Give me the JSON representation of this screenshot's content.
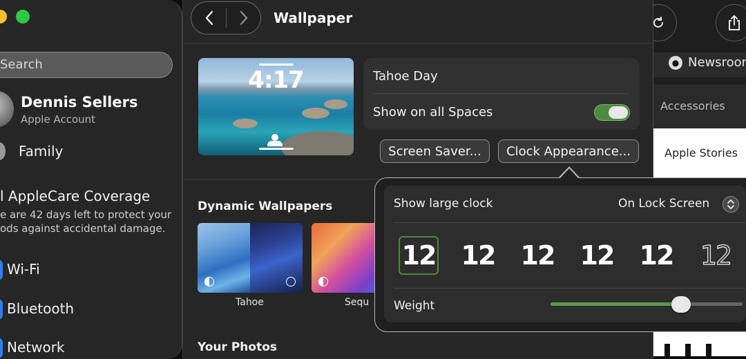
{
  "sidebar": {
    "search_placeholder": "Search",
    "account": {
      "name": "Dennis Sellers",
      "subtitle": "Apple Account"
    },
    "family_label": "Family",
    "applecare": {
      "title": "l AppleCare Coverage",
      "line1": "e are 42 days left to protect your",
      "line2": "ods against accidental damage."
    },
    "items": [
      {
        "label": "Wi-Fi",
        "icon": "wifi-icon"
      },
      {
        "label": "Bluetooth",
        "icon": "bluetooth-icon"
      },
      {
        "label": "Network",
        "icon": "network-icon"
      }
    ]
  },
  "toolbar": {
    "title": "Wallpaper"
  },
  "wallpaper": {
    "preview_time": "4:17",
    "name": "Tahoe Day",
    "show_on_all_spaces_label": "Show on all Spaces",
    "show_on_all_spaces": true,
    "screen_saver_button": "Screen Saver...",
    "clock_appearance_button": "Clock Appearance..."
  },
  "dynamic_wallpapers": {
    "title": "Dynamic Wallpapers",
    "items": [
      {
        "label": "Tahoe"
      },
      {
        "label": "Sequ"
      }
    ]
  },
  "your_photos_title": "Your Photos",
  "clock_popover": {
    "show_large_clock_label": "Show large clock",
    "show_large_clock_value": "On Lock Screen",
    "styles": [
      "12",
      "12",
      "12",
      "12",
      "12",
      "12"
    ],
    "selected_style_index": 0,
    "weight_label": "Weight",
    "weight_value": 0.68
  },
  "safari": {
    "tab_label": "Newsroom",
    "nav_item": "Accessories",
    "page_item": "Apple Stories"
  },
  "colors": {
    "accent_green": "#5b9a4a",
    "toggle_green": "#4d8a3d",
    "traffic_yellow": "#f5bf2f",
    "traffic_green": "#2fc845",
    "network_blue": "#2f7ef4"
  }
}
